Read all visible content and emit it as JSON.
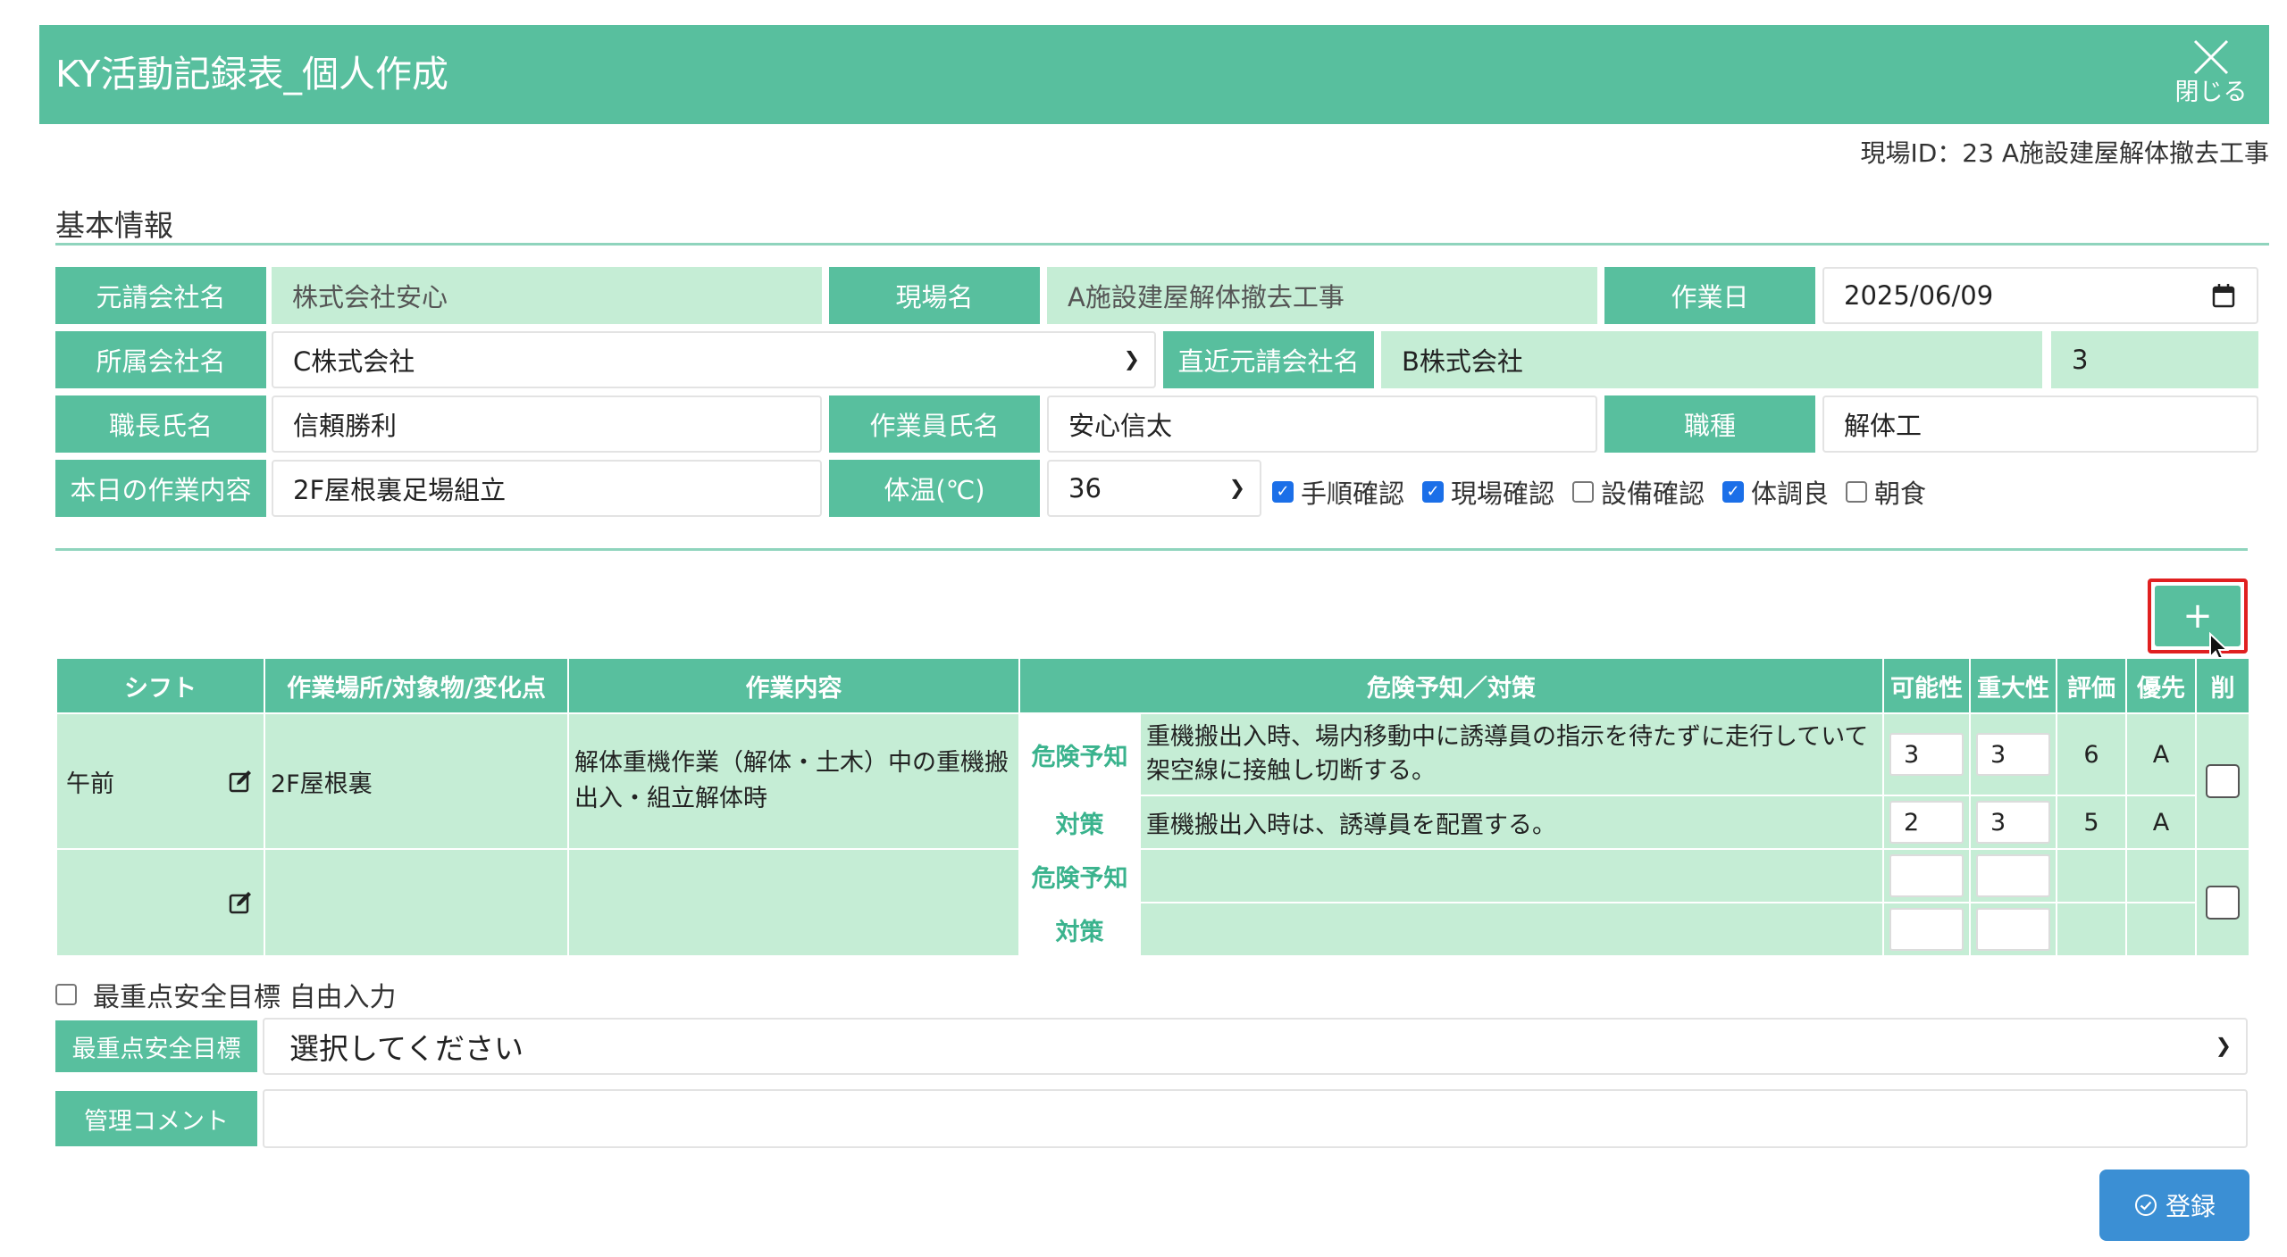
{
  "header": {
    "title": "KY活動記録表_個人作成",
    "close_label": "閉じる",
    "background": "#58bf9e"
  },
  "site_id": "現場ID：23 A施設建屋解体撤去工事",
  "section_title": "基本情報",
  "basic": {
    "prime_contractor_label": "元請会社名",
    "prime_contractor_value": "株式会社安心",
    "site_name_label": "現場名",
    "site_name_value": "A施設建屋解体撤去工事",
    "work_date_label": "作業日",
    "work_date_value": "2025/06/09",
    "company_label": "所属会社名",
    "company_value": "C株式会社",
    "direct_contractor_label": "直近元請会社名",
    "direct_contractor_value": "B株式会社",
    "direct_contractor_extra": "3",
    "foreman_label": "職長氏名",
    "foreman_value": "信頼勝利",
    "worker_label": "作業員氏名",
    "worker_value": "安心信太",
    "occupation_label": "職種",
    "occupation_value": "解体工",
    "today_work_label": "本日の作業内容",
    "today_work_value": "2F屋根裏足場組立",
    "temp_label": "体温(℃)",
    "temp_value": "36",
    "checks": [
      {
        "label": "手順確認",
        "checked": true
      },
      {
        "label": "現場確認",
        "checked": true
      },
      {
        "label": "設備確認",
        "checked": false
      },
      {
        "label": "体調良",
        "checked": true
      },
      {
        "label": "朝食",
        "checked": false
      }
    ]
  },
  "add_button_label": "+",
  "table": {
    "headers": {
      "shift": "シフト",
      "place": "作業場所/対象物/変化点",
      "content": "作業内容",
      "risk": "危険予知／対策",
      "possibility": "可能性",
      "severity": "重大性",
      "evaluation": "評価",
      "priority": "優先",
      "delete": "削"
    },
    "rows": [
      {
        "shift": "午前",
        "place": "2F屋根裏",
        "content": "解体重機作業（解体・土木）中の重機搬出入・組立解体時",
        "risk_tag": "危険予知",
        "risk_text": "重機搬出入時、場内移動中に誘導員の指示を待たずに走行していて架空線に接触し切断する。",
        "risk_possibility": "3",
        "risk_severity": "3",
        "risk_evaluation": "6",
        "risk_priority": "A",
        "measure_tag": "対策",
        "measure_text": "重機搬出入時は、誘導員を配置する。",
        "measure_possibility": "2",
        "measure_severity": "3",
        "measure_evaluation": "5",
        "measure_priority": "A"
      },
      {
        "shift": "",
        "place": "",
        "content": "",
        "risk_tag": "危険予知",
        "risk_text": "",
        "measure_tag": "対策",
        "measure_text": ""
      }
    ]
  },
  "free_input_label": "最重点安全目標 自由入力",
  "goal_label": "最重点安全目標",
  "goal_placeholder": "選択してください",
  "comment_label": "管理コメント",
  "comment_value": "",
  "register_label": "登録",
  "colors": {
    "accent": "#58bf9e",
    "light": "#c5edd5",
    "register": "#3b8fd4",
    "highlight": "#e02020"
  }
}
